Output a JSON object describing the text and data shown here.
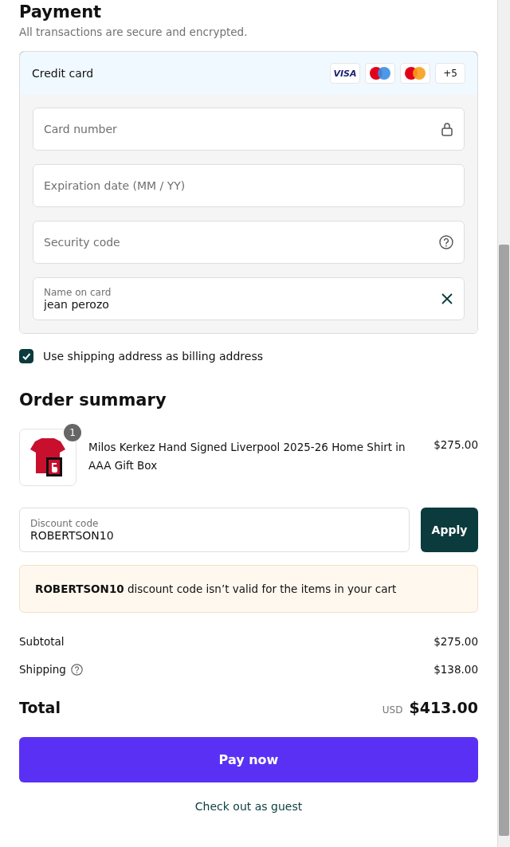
{
  "payment": {
    "heading": "Payment",
    "subtitle": "All transactions are secure and encrypted.",
    "method": {
      "label": "Credit card",
      "selected": true,
      "brands": [
        {
          "kind": "visa",
          "text": "VISA"
        },
        {
          "kind": "maestro"
        },
        {
          "kind": "mastercard"
        },
        {
          "kind": "more",
          "text": "+5"
        }
      ]
    },
    "fields": [
      {
        "kind": "lock",
        "placeholder": "Card number"
      },
      {
        "kind": "plain",
        "placeholder": "Expiration date (MM / YY)"
      },
      {
        "kind": "help",
        "placeholder": "Security code"
      },
      {
        "kind": "clear",
        "label": "Name on card",
        "value": "jean perozo"
      }
    ],
    "billing_checkbox": {
      "label": "Use shipping address as billing address",
      "checked": true
    }
  },
  "order_summary": {
    "heading": "Order summary",
    "items": [
      {
        "quantity": "1",
        "title": "Milos Kerkez Hand Signed Liverpool 2025-26 Home Shirt in AAA Gift Box",
        "price": "$275.00"
      }
    ],
    "discount": {
      "label": "Discount code",
      "value": "ROBERTSON10",
      "button": "Apply"
    },
    "notice": {
      "code": "ROBERTSON10",
      "message": " discount code isn’t valid for the items in your cart"
    },
    "lines": [
      {
        "label": "Subtotal",
        "value": "$275.00",
        "help": false
      },
      {
        "label": "Shipping",
        "value": "$138.00",
        "help": true
      }
    ],
    "total": {
      "label": "Total",
      "currency": "USD",
      "value": "$413.00"
    }
  },
  "actions": {
    "pay": "Pay now",
    "guest": "Check out as guest"
  }
}
